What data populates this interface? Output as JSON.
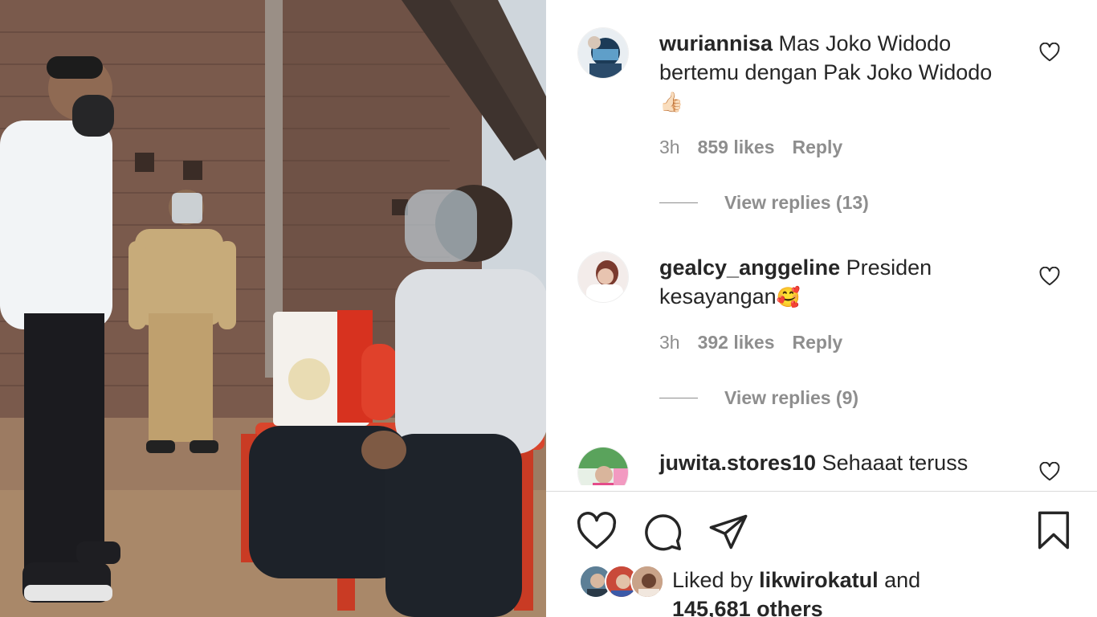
{
  "post": {
    "photo_alt": "",
    "comments": [
      {
        "username": "wuriannisa",
        "text": " Mas Joko Widodo bertemu dengan Pak Joko Widodo",
        "emoji": "👍🏻",
        "time": "3h",
        "likes": "859 likes",
        "reply_label": "Reply",
        "view_replies": "View replies (13)",
        "avatar_icon": "profile-photo"
      },
      {
        "username": "gealcy_anggeline",
        "text": " Presiden kesayangan",
        "emoji": "🥰",
        "time": "3h",
        "likes": "392 likes",
        "reply_label": "Reply",
        "view_replies": "View replies (9)",
        "avatar_icon": "profile-photo"
      },
      {
        "username": "juwita.stores10",
        "text": " Sehaaat teruss",
        "emoji": "❤",
        "avatar_icon": "profile-photo"
      }
    ],
    "actions": {
      "like_icon": "heart-icon",
      "comment_icon": "comment-icon",
      "share_icon": "send-icon",
      "save_icon": "bookmark-icon"
    },
    "liked_by": {
      "prefix": "Liked by ",
      "user": "likwirokatul",
      "suffix": " and",
      "others": "145,681 others"
    },
    "colors": {
      "text": "#262626",
      "secondary": "#8e8e8e",
      "divider": "#dbdbdb",
      "emoji_heart": "#ed4956"
    }
  }
}
